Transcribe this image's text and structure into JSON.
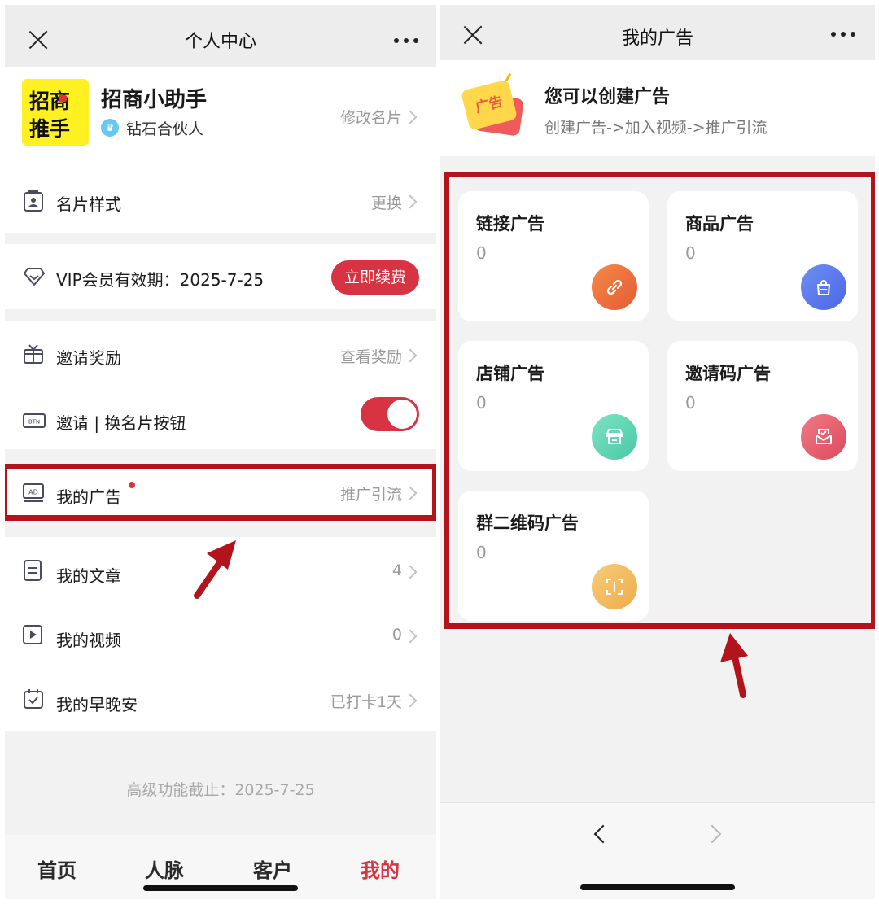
{
  "left": {
    "header": {
      "title": "个人中心"
    },
    "profile": {
      "logo_line1": "招商",
      "logo_line2": "推手",
      "name": "招商小助手",
      "level": "钻石合伙人",
      "edit_label": "修改名片"
    },
    "rows": {
      "card_style": {
        "label": "名片样式",
        "right": "更换"
      },
      "vip": {
        "label": "VIP会员有效期：2025-7-25",
        "button": "立即续费"
      },
      "invite_reward": {
        "label": "邀请奖励",
        "right": "查看奖励"
      },
      "invite_button": {
        "label": "邀请 | 换名片按钮",
        "toggle_on": true
      },
      "my_ads": {
        "label": "我的广告",
        "right": "推广引流"
      },
      "my_articles": {
        "label": "我的文章",
        "right": "4"
      },
      "my_videos": {
        "label": "我的视频",
        "right": "0"
      },
      "my_checkin": {
        "label": "我的早晚安",
        "right": "已打卡1天"
      }
    },
    "expire_text": "高级功能截止：2025-7-25",
    "tabbar": [
      "首页",
      "人脉",
      "客户",
      "我的"
    ],
    "tab_active_color": "#d83342"
  },
  "right": {
    "header": {
      "title": "我的广告"
    },
    "intro": {
      "badge_text": "广告",
      "title": "您可以创建广告",
      "subtitle": "创建广告->加入视频->推广引流"
    },
    "cards": [
      {
        "title": "链接广告",
        "count": "0",
        "icon": "link-icon",
        "color": "#ef6a3c"
      },
      {
        "title": "商品广告",
        "count": "0",
        "icon": "shopping-bag-icon",
        "color": "#5a7cf0"
      },
      {
        "title": "店铺广告",
        "count": "0",
        "icon": "store-icon",
        "color": "#5fd6b4"
      },
      {
        "title": "邀请码广告",
        "count": "0",
        "icon": "envelope-icon",
        "color": "#e85b6c"
      },
      {
        "title": "群二维码广告",
        "count": "0",
        "icon": "scan-icon",
        "color": "#f2bb5e"
      }
    ]
  },
  "accent_color": "#b3131a"
}
